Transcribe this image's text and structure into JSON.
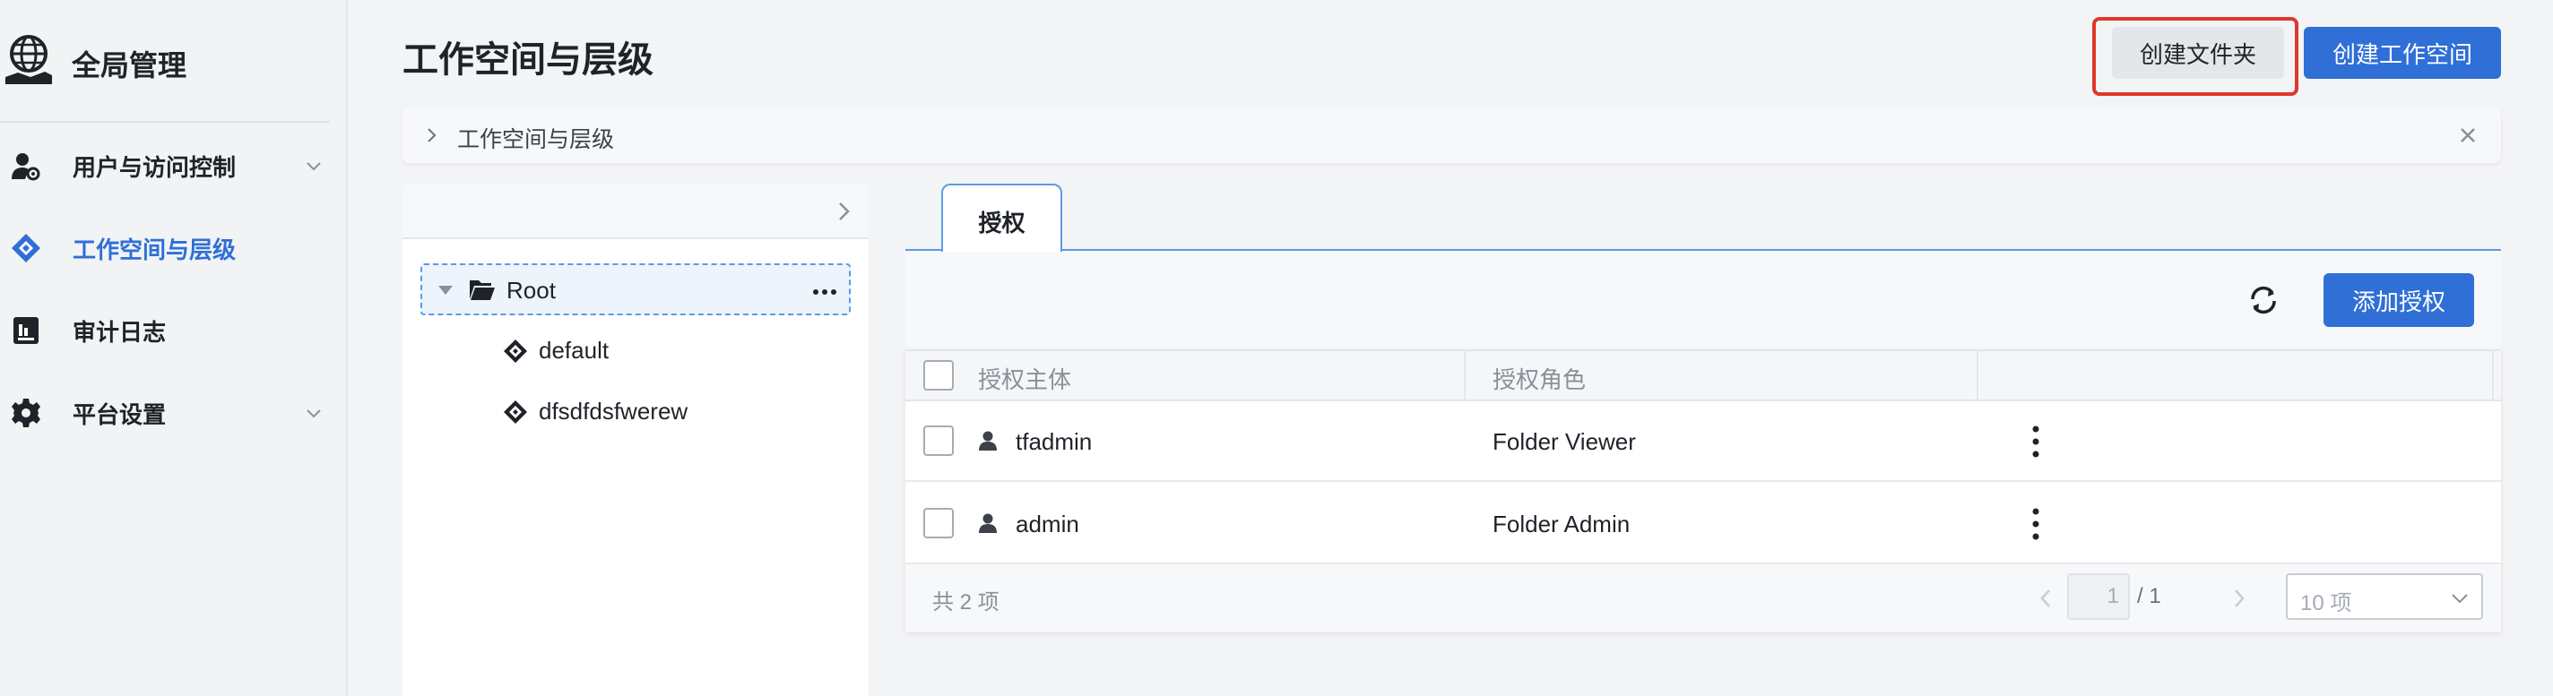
{
  "sidebar": {
    "brand": {
      "title": "全局管理",
      "icon": "globe-hand-icon"
    },
    "items": [
      {
        "label": "用户与访问控制",
        "icon": "user-gear-icon",
        "expandable": true,
        "active": false
      },
      {
        "label": "工作空间与层级",
        "icon": "workspace-diamond-icon",
        "expandable": false,
        "active": true
      },
      {
        "label": "审计日志",
        "icon": "audit-chart-icon",
        "expandable": false,
        "active": false
      },
      {
        "label": "平台设置",
        "icon": "gear-icon",
        "expandable": true,
        "active": false
      }
    ]
  },
  "header": {
    "title": "工作空间与层级",
    "create_folder_label": "创建文件夹",
    "create_workspace_label": "创建工作空间"
  },
  "breadcrumb": {
    "text": "工作空间与层级"
  },
  "tree": {
    "root": {
      "label": "Root"
    },
    "children": [
      {
        "label": "default"
      },
      {
        "label": "dfsdfdsfwerew"
      }
    ]
  },
  "tabs": [
    {
      "label": "授权",
      "active": true
    }
  ],
  "toolbar": {
    "add_label": "添加授权"
  },
  "table": {
    "columns": [
      "授权主体",
      "授权角色",
      ""
    ],
    "rows": [
      {
        "subject": "tfadmin",
        "role": "Folder Viewer"
      },
      {
        "subject": "admin",
        "role": "Folder Admin"
      }
    ]
  },
  "pagination": {
    "total": "共 2 项",
    "current_page": "1",
    "page_total": "/ 1",
    "page_size": "10 项"
  },
  "colors": {
    "accent": "#2f6fd6",
    "highlight": "#e0372c",
    "sidebar_bg": "#f2f3f5",
    "page_bg": "#f3f4f6"
  }
}
